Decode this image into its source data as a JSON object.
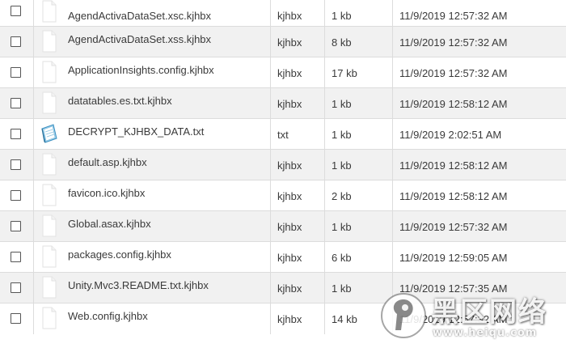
{
  "files": [
    {
      "name": "AgendActivaDataSet.xsc.kjhbx",
      "type": "kjhbx",
      "size": "1 kb",
      "modified": "11/9/2019 12:57:32 AM",
      "icon": "blank-file-icon"
    },
    {
      "name": "AgendActivaDataSet.xss.kjhbx",
      "type": "kjhbx",
      "size": "8 kb",
      "modified": "11/9/2019 12:57:32 AM",
      "icon": "blank-file-icon"
    },
    {
      "name": "ApplicationInsights.config.kjhbx",
      "type": "kjhbx",
      "size": "17 kb",
      "modified": "11/9/2019 12:57:32 AM",
      "icon": "blank-file-icon"
    },
    {
      "name": "datatables.es.txt.kjhbx",
      "type": "kjhbx",
      "size": "1 kb",
      "modified": "11/9/2019 12:58:12 AM",
      "icon": "blank-file-icon"
    },
    {
      "name": "DECRYPT_KJHBX_DATA.txt",
      "type": "txt",
      "size": "1 kb",
      "modified": "11/9/2019 2:02:51 AM",
      "icon": "notepad-file-icon"
    },
    {
      "name": "default.asp.kjhbx",
      "type": "kjhbx",
      "size": "1 kb",
      "modified": "11/9/2019 12:58:12 AM",
      "icon": "blank-file-icon"
    },
    {
      "name": "favicon.ico.kjhbx",
      "type": "kjhbx",
      "size": "2 kb",
      "modified": "11/9/2019 12:58:12 AM",
      "icon": "blank-file-icon"
    },
    {
      "name": "Global.asax.kjhbx",
      "type": "kjhbx",
      "size": "1 kb",
      "modified": "11/9/2019 12:57:32 AM",
      "icon": "blank-file-icon"
    },
    {
      "name": "packages.config.kjhbx",
      "type": "kjhbx",
      "size": "6 kb",
      "modified": "11/9/2019 12:59:05 AM",
      "icon": "blank-file-icon"
    },
    {
      "name": "Unity.Mvc3.README.txt.kjhbx",
      "type": "kjhbx",
      "size": "1 kb",
      "modified": "11/9/2019 12:57:35 AM",
      "icon": "blank-file-icon"
    },
    {
      "name": "Web.config.kjhbx",
      "type": "kjhbx",
      "size": "14 kb",
      "modified": "11/9/2019 12:57:32 AM",
      "icon": "blank-file-icon"
    }
  ],
  "watermark": {
    "text": "黑区网络",
    "url": "www.heiqu.com"
  },
  "colors": {
    "row_alt": "#f1f1f1",
    "border": "#dcdcdc",
    "text": "#3a3a3a"
  }
}
